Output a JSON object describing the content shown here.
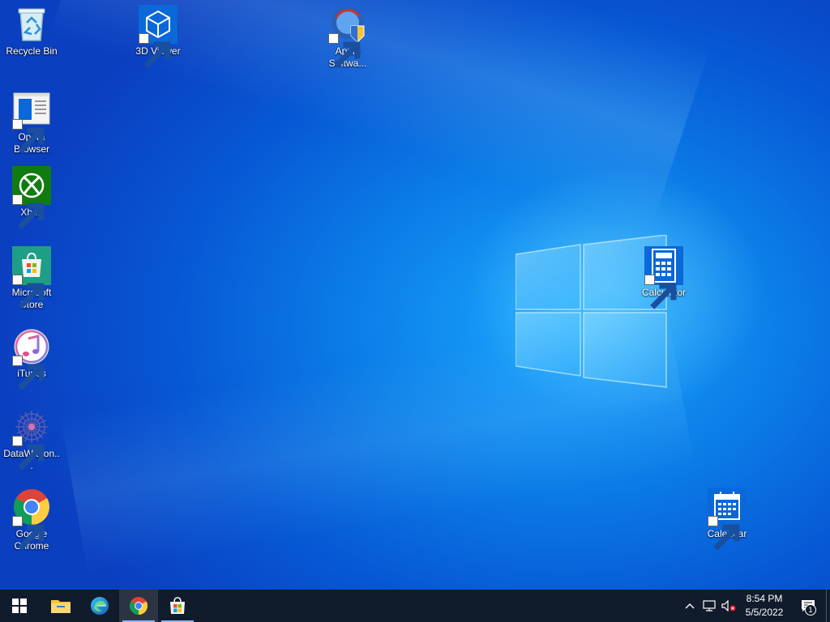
{
  "desktop": {
    "icons": [
      {
        "label": "Recycle Bin",
        "icon": "recycle-bin-icon",
        "shortcut": false
      },
      {
        "label": "3D Viewer",
        "icon": "3d-viewer-icon",
        "shortcut": true
      },
      {
        "label": "Apple Softwa...",
        "icon": "apple-software-update-icon",
        "shortcut": true
      },
      {
        "label": "Opera Browser",
        "icon": "opera-browser-icon",
        "shortcut": true
      },
      {
        "label": "Xbox",
        "icon": "xbox-icon",
        "shortcut": true
      },
      {
        "label": "Microsoft Store",
        "icon": "microsoft-store-icon",
        "shortcut": true
      },
      {
        "label": "iTunes",
        "icon": "itunes-icon",
        "shortcut": true
      },
      {
        "label": "DataWagon...",
        "icon": "datawagon-icon",
        "shortcut": true
      },
      {
        "label": "Google Chrome",
        "icon": "google-chrome-icon",
        "shortcut": true
      },
      {
        "label": "Calculator",
        "icon": "calculator-icon",
        "shortcut": true
      },
      {
        "label": "Calendar",
        "icon": "calendar-icon",
        "shortcut": true
      }
    ]
  },
  "taskbar": {
    "start": "windows-start-icon",
    "pinned": [
      {
        "name": "file-explorer",
        "icon": "folder-icon",
        "active": false
      },
      {
        "name": "edge",
        "icon": "edge-icon",
        "active": false
      },
      {
        "name": "chrome",
        "icon": "chrome-icon",
        "active": true
      },
      {
        "name": "store",
        "icon": "store-icon",
        "active": false
      }
    ],
    "tray": {
      "chevron": "chevron-up-icon",
      "network": "network-icon",
      "volume": "volume-muted-icon",
      "time": "8:54 PM",
      "date": "5/5/2022",
      "notifications_count": "1"
    }
  },
  "colors": {
    "taskbar": "#101c2c",
    "desktop_blue": "#0b7be6",
    "accent": "#8ab4f8"
  }
}
